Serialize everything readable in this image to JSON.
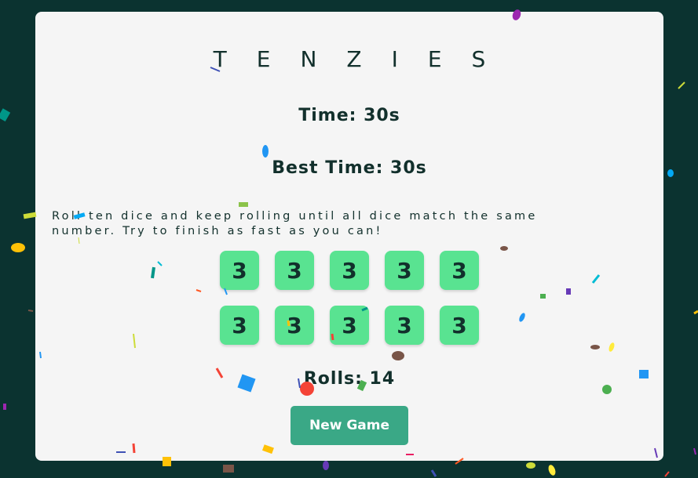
{
  "game": {
    "title": "TENZIES",
    "timer_text": "Time: 30s",
    "best_time_text": "Best Time: 30s",
    "instructions": "Roll ten dice and keep rolling until all dice match the same number. Try to finish as fast as you can!",
    "dice": [
      3,
      3,
      3,
      3,
      3,
      3,
      3,
      3,
      3,
      3
    ],
    "rolls_text": "Rolls: 14",
    "new_game_label": "New Game"
  },
  "colors": {
    "background": "#0b3330",
    "card": "#f5f5f5",
    "die": "#59e391",
    "button": "#3aa886",
    "text": "#12302c"
  }
}
